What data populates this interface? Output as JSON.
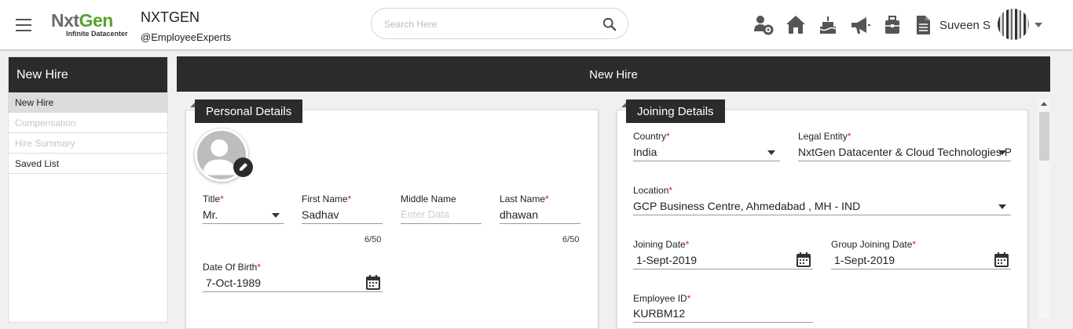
{
  "brand": {
    "logo_main_1": "Nxt",
    "logo_main_2": "Gen",
    "logo_sub": "Infinite Datacenter",
    "org_name": "NXTGEN",
    "org_handle": "@EmployeeExperts"
  },
  "search": {
    "placeholder": "Search Here"
  },
  "header_icons": [
    "team-settings-icon",
    "home-icon",
    "birthday-cake-icon",
    "megaphone-icon",
    "briefcase-icon",
    "document-icon"
  ],
  "user": {
    "name": "Suveen S"
  },
  "sidebar": {
    "title": "New Hire",
    "items": [
      {
        "label": "New Hire",
        "state": "active"
      },
      {
        "label": "Compensation",
        "state": "disabled"
      },
      {
        "label": "Hire Summary",
        "state": "disabled"
      },
      {
        "label": "Saved List",
        "state": "normal"
      }
    ]
  },
  "main": {
    "title": "New Hire"
  },
  "personal": {
    "tab": "Personal Details",
    "title_label": "Title",
    "title_value": "Mr.",
    "first_name_label": "First Name",
    "first_name_value": "Sadhav",
    "first_name_count": "6/50",
    "middle_name_label": "Middle Name",
    "middle_name_placeholder": "Enter Data",
    "last_name_label": "Last Name",
    "last_name_value": "dhawan",
    "last_name_count": "6/50",
    "dob_label": "Date Of Birth",
    "dob_value": "7-Oct-1989"
  },
  "joining": {
    "tab": "Joining Details",
    "country_label": "Country",
    "country_value": "India",
    "legal_entity_label": "Legal Entity",
    "legal_entity_value": "NxtGen Datacenter & Cloud Technologies Pr",
    "location_label": "Location",
    "location_value": "GCP Business Centre, Ahmedabad , MH - IND",
    "joining_date_label": "Joining Date",
    "joining_date_value": "1-Sept-2019",
    "group_joining_date_label": "Group Joining Date",
    "group_joining_date_value": "1-Sept-2019",
    "employee_id_label": "Employee ID",
    "employee_id_value": "KURBM12"
  },
  "required_mark": "*",
  "colors": {
    "header_dark": "#2b2b2b",
    "brand_green": "#5aa02c",
    "required": "#d21f2a"
  }
}
